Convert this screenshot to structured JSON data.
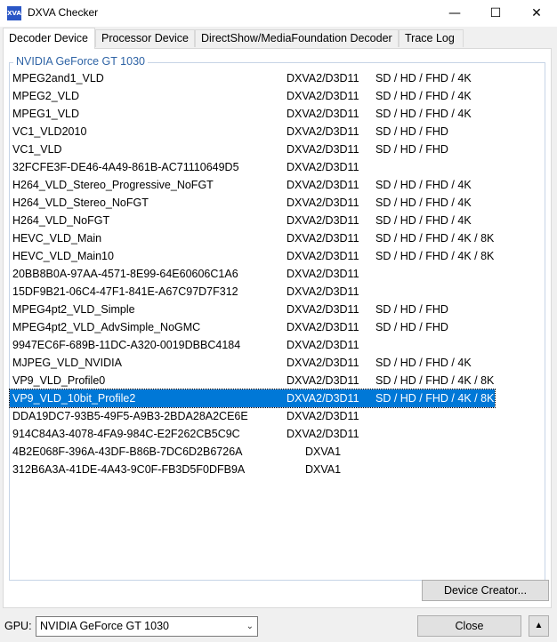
{
  "window": {
    "app_icon_text": "XVA",
    "title": "DXVA Checker",
    "minimize": "—",
    "maximize": "☐",
    "close": "✕"
  },
  "tabs": [
    {
      "label": "Decoder Device"
    },
    {
      "label": "Processor Device"
    },
    {
      "label": "DirectShow/MediaFoundation Decoder"
    },
    {
      "label": "Trace Log"
    }
  ],
  "group_label": "NVIDIA GeForce GT 1030",
  "decoders": [
    {
      "name": "MPEG2and1_VLD",
      "api": "DXVA2/D3D11",
      "res": "SD / HD / FHD / 4K"
    },
    {
      "name": "MPEG2_VLD",
      "api": "DXVA2/D3D11",
      "res": "SD / HD / FHD / 4K"
    },
    {
      "name": "MPEG1_VLD",
      "api": "DXVA2/D3D11",
      "res": "SD / HD / FHD / 4K"
    },
    {
      "name": "VC1_VLD2010",
      "api": "DXVA2/D3D11",
      "res": "SD / HD / FHD"
    },
    {
      "name": "VC1_VLD",
      "api": "DXVA2/D3D11",
      "res": "SD / HD / FHD"
    },
    {
      "name": "32FCFE3F-DE46-4A49-861B-AC71110649D5",
      "api": "DXVA2/D3D11",
      "res": ""
    },
    {
      "name": "H264_VLD_Stereo_Progressive_NoFGT",
      "api": "DXVA2/D3D11",
      "res": "SD / HD / FHD / 4K"
    },
    {
      "name": "H264_VLD_Stereo_NoFGT",
      "api": "DXVA2/D3D11",
      "res": "SD / HD / FHD / 4K"
    },
    {
      "name": "H264_VLD_NoFGT",
      "api": "DXVA2/D3D11",
      "res": "SD / HD / FHD / 4K"
    },
    {
      "name": "HEVC_VLD_Main",
      "api": "DXVA2/D3D11",
      "res": "SD / HD / FHD / 4K / 8K"
    },
    {
      "name": "HEVC_VLD_Main10",
      "api": "DXVA2/D3D11",
      "res": "SD / HD / FHD / 4K / 8K"
    },
    {
      "name": "20BB8B0A-97AA-4571-8E99-64E60606C1A6",
      "api": "DXVA2/D3D11",
      "res": ""
    },
    {
      "name": "15DF9B21-06C4-47F1-841E-A67C97D7F312",
      "api": "DXVA2/D3D11",
      "res": ""
    },
    {
      "name": "MPEG4pt2_VLD_Simple",
      "api": "DXVA2/D3D11",
      "res": "SD / HD / FHD"
    },
    {
      "name": "MPEG4pt2_VLD_AdvSimple_NoGMC",
      "api": "DXVA2/D3D11",
      "res": "SD / HD / FHD"
    },
    {
      "name": "9947EC6F-689B-11DC-A320-0019DBBC4184",
      "api": "DXVA2/D3D11",
      "res": ""
    },
    {
      "name": "MJPEG_VLD_NVIDIA",
      "api": "DXVA2/D3D11",
      "res": "SD / HD / FHD / 4K"
    },
    {
      "name": "VP9_VLD_Profile0",
      "api": "DXVA2/D3D11",
      "res": "SD / HD / FHD / 4K / 8K"
    },
    {
      "name": "VP9_VLD_10bit_Profile2",
      "api": "DXVA2/D3D11",
      "res": "SD / HD / FHD / 4K / 8K"
    },
    {
      "name": "DDA19DC7-93B5-49F5-A9B3-2BDA28A2CE6E",
      "api": "DXVA2/D3D11",
      "res": ""
    },
    {
      "name": "914C84A3-4078-4FA9-984C-E2F262CB5C9C",
      "api": "DXVA2/D3D11",
      "res": ""
    },
    {
      "name": "4B2E068F-396A-43DF-B86B-7DC6D2B6726A",
      "api": "DXVA1",
      "res": ""
    },
    {
      "name": "312B6A3A-41DE-4A43-9C0F-FB3D5F0DFB9A",
      "api": "DXVA1",
      "res": ""
    }
  ],
  "buttons": {
    "device_creator": "Device Creator...",
    "close": "Close",
    "scroll_up": "▲"
  },
  "gpu": {
    "label": "GPU:",
    "selected": "NVIDIA GeForce GT 1030",
    "arrow": "⌄"
  },
  "colors": {
    "selection": "#0078d7",
    "group_label": "#2e63a5"
  }
}
